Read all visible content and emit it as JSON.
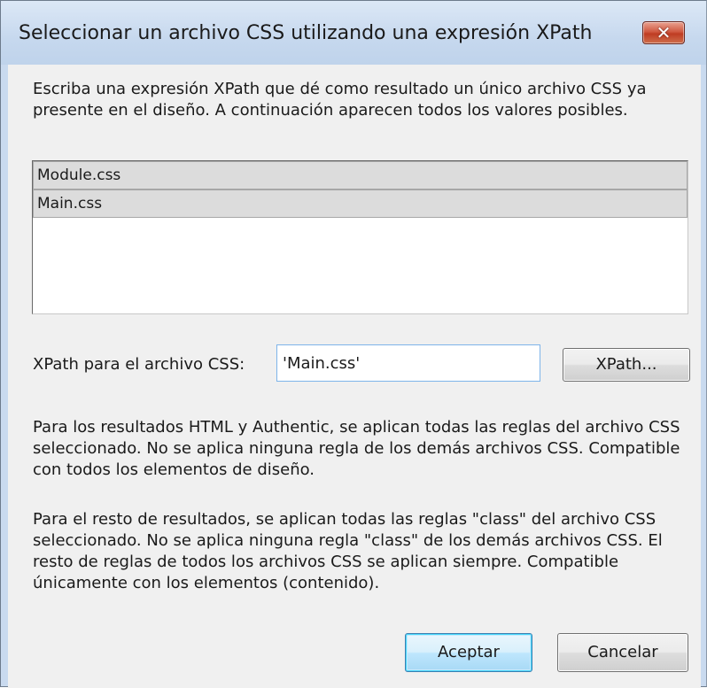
{
  "dialog": {
    "title": "Seleccionar un archivo CSS utilizando una expresión XPath",
    "close_label": "✕",
    "intro": "Escriba una expresión XPath que dé como resultado un único archivo CSS ya presente en el diseño. A continuación aparecen todos los valores posibles.",
    "list_items": [
      {
        "label": "Module.css"
      },
      {
        "label": "Main.css"
      }
    ],
    "xpath_label": "XPath para el archivo CSS:",
    "xpath_value": "'Main.css'",
    "xpath_button": "XPath...",
    "paragraph1": "Para los resultados HTML y Authentic, se aplican todas las reglas del archivo CSS seleccionado. No se aplica ninguna regla de los demás archivos CSS. Compatible con todos los elementos de diseño.",
    "paragraph2": "Para el resto de resultados, se aplican todas las reglas \"class\" del archivo CSS seleccionado. No se aplica ninguna regla \"class\" de los demás archivos CSS. El resto de reglas de todos los archivos CSS se aplican siempre. Compatible únicamente con los elementos (contenido).",
    "ok_label": "Aceptar",
    "cancel_label": "Cancelar"
  },
  "colors": {
    "titlebar": "#c9daef",
    "close_button": "#c94a30",
    "client_bg": "#f0f0f0",
    "list_item_bg": "#dcdcdc",
    "default_button_border": "#3c7fb1"
  }
}
